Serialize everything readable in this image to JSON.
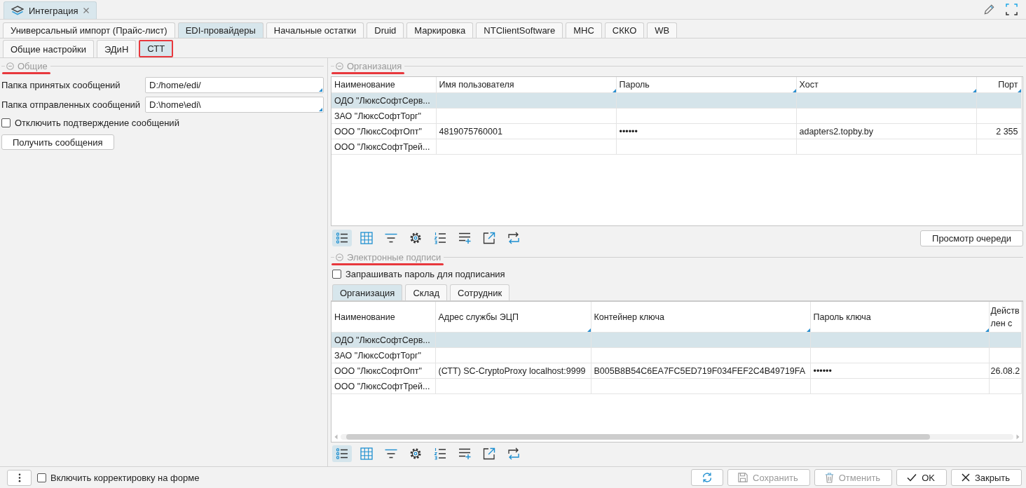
{
  "document_tab": {
    "title": "Интеграция"
  },
  "tabs": [
    {
      "label": "Универсальный импорт (Прайс-лист)",
      "selected": false
    },
    {
      "label": "EDI-провайдеры",
      "selected": true
    },
    {
      "label": "Начальные остатки",
      "selected": false
    },
    {
      "label": "Druid",
      "selected": false
    },
    {
      "label": "Маркировка",
      "selected": false
    },
    {
      "label": "NTClientSoftware",
      "selected": false
    },
    {
      "label": "МНС",
      "selected": false
    },
    {
      "label": "СККО",
      "selected": false
    },
    {
      "label": "WB",
      "selected": false
    }
  ],
  "subtabs": [
    {
      "label": "Общие настройки",
      "selected": false,
      "highlighted": false
    },
    {
      "label": "ЭДиН",
      "selected": false,
      "highlighted": false
    },
    {
      "label": "СТТ",
      "selected": true,
      "highlighted": true
    }
  ],
  "general": {
    "title": "Общие",
    "underlined": true,
    "fields": [
      {
        "label": "Папка принятых сообщений",
        "value": "D:/home/edi/"
      },
      {
        "label": "Папка отправленных сообщений",
        "value": "D:\\home\\edi\\"
      }
    ],
    "checkbox": {
      "label": "Отключить подтверждение сообщений",
      "checked": false
    },
    "button": "Получить сообщения"
  },
  "organization": {
    "title": "Организация",
    "underlined": true,
    "table": {
      "columns": [
        {
          "title": "Наименование",
          "marker": false
        },
        {
          "title": "Имя пользователя",
          "marker": true
        },
        {
          "title": "Пароль",
          "marker": true
        },
        {
          "title": "Хост",
          "marker": true
        },
        {
          "title": "Порт",
          "marker": true
        }
      ],
      "rows": [
        {
          "selected": true,
          "cells": [
            "ОДО \"ЛюксСофтСерв..."
          ]
        },
        {
          "selected": false,
          "cells": [
            "ЗАО \"ЛюксСофтТорг\""
          ]
        },
        {
          "selected": false,
          "cells": [
            "ООО \"ЛюксСофтОпт\"",
            "4819075760001",
            "••••••",
            "adapters2.topby.by",
            "2 355"
          ]
        },
        {
          "selected": false,
          "cells": [
            "ООО \"ЛюксСофтТрей..."
          ]
        }
      ]
    },
    "toolbar": [
      {
        "kind": "list",
        "selected": true
      },
      {
        "kind": "grid",
        "selected": false
      },
      {
        "kind": "filter",
        "selected": false
      },
      {
        "kind": "settings",
        "selected": false
      },
      {
        "kind": "numbered",
        "selected": false
      },
      {
        "kind": "add-row",
        "selected": false
      },
      {
        "kind": "export",
        "selected": false
      },
      {
        "kind": "swap",
        "selected": false
      }
    ],
    "queue_button": "Просмотр очереди"
  },
  "signatures": {
    "title": "Электронные подписи",
    "underlined": true,
    "checkbox": {
      "label": "Запрашивать пароль для подписания",
      "checked": false
    },
    "tabs": [
      {
        "label": "Организация",
        "selected": true
      },
      {
        "label": "Склад",
        "selected": false
      },
      {
        "label": "Сотрудник",
        "selected": false
      }
    ],
    "table": {
      "columns": [
        {
          "title": "Наименование",
          "marker": false
        },
        {
          "title": "Адрес службы ЭЦП",
          "marker": true
        },
        {
          "title": "Контейнер ключа",
          "marker": true
        },
        {
          "title": "Пароль ключа",
          "marker": true
        },
        {
          "title": "Действ\nлен с",
          "marker": false
        }
      ],
      "rows": [
        {
          "selected": true,
          "cells": [
            "ОДО \"ЛюксСофтСерв..."
          ]
        },
        {
          "selected": false,
          "cells": [
            "ЗАО \"ЛюксСофтТорг\""
          ]
        },
        {
          "selected": false,
          "cells": [
            "ООО \"ЛюксСофтОпт\"",
            "(СТТ) SC-CryptoProxy localhost:9999",
            "B005B8B54C6EA7FC5ED719F034FEF2C4B49719FA",
            "••••••",
            "26.08.2"
          ]
        },
        {
          "selected": false,
          "cells": [
            "ООО \"ЛюксСофтТрей..."
          ]
        }
      ]
    },
    "toolbar": [
      {
        "kind": "list",
        "selected": true
      },
      {
        "kind": "grid",
        "selected": false
      },
      {
        "kind": "filter",
        "selected": false
      },
      {
        "kind": "settings",
        "selected": false
      },
      {
        "kind": "numbered",
        "selected": false
      },
      {
        "kind": "add-row",
        "selected": false
      },
      {
        "kind": "export",
        "selected": false
      },
      {
        "kind": "swap",
        "selected": false
      }
    ]
  },
  "footer": {
    "checkbox": {
      "label": "Включить корректировку на форме",
      "checked": false
    },
    "buttons": [
      {
        "kind": "refresh",
        "disabled": false
      },
      {
        "kind": "save",
        "label": "Сохранить",
        "disabled": true
      },
      {
        "kind": "cancel",
        "label": "Отменить",
        "disabled": true
      },
      {
        "kind": "ok",
        "label": "OK",
        "disabled": false
      },
      {
        "kind": "close",
        "label": "Закрыть",
        "disabled": false
      }
    ]
  }
}
